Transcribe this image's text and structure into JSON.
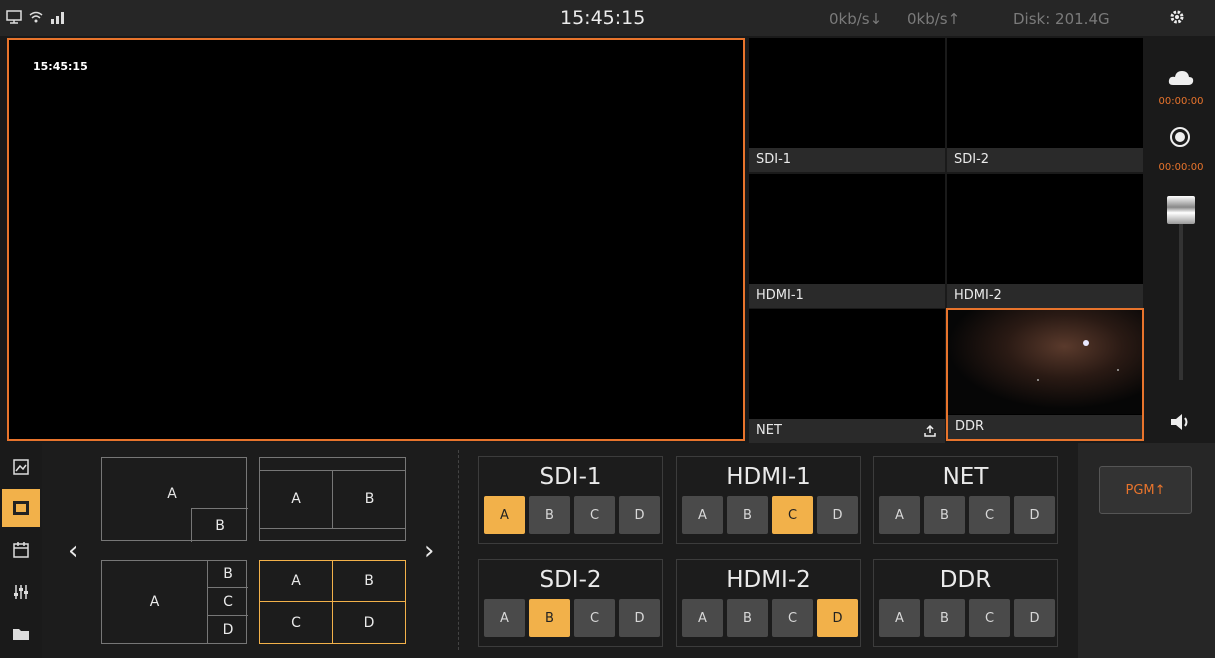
{
  "status": {
    "clock": "15:45:15",
    "down_rate": "0kb/s↓",
    "up_rate": "0kb/s↑",
    "disk": "Disk: 201.4G",
    "icons": [
      "monitor-icon",
      "wifi-icon",
      "signal-icon",
      "gear-icon"
    ]
  },
  "preview": {
    "timestamp": "15:45:15"
  },
  "sources": [
    {
      "label": "SDI-1"
    },
    {
      "label": "SDI-2"
    },
    {
      "label": "HDMI-1"
    },
    {
      "label": "HDMI-2"
    },
    {
      "label": "NET"
    },
    {
      "label": "DDR"
    }
  ],
  "rail": {
    "stream_timer": "00:00:00",
    "record_timer": "00:00:00",
    "icons": [
      "cloud-stream-icon",
      "record-icon",
      "volume-fader",
      "speaker-icon"
    ]
  },
  "sidebar": {
    "icons": [
      "image-icon",
      "pip-icon",
      "calendar-icon",
      "mixer-icon",
      "folder-icon"
    ],
    "active_index": 1
  },
  "layouts": {
    "pip": {
      "main": "A",
      "inset": "B"
    },
    "side_by_side": {
      "left": "A",
      "right": "B"
    },
    "one_plus_three": {
      "main": "A",
      "right": [
        "B",
        "C",
        "D"
      ]
    },
    "quad": {
      "cells": [
        "A",
        "B",
        "C",
        "D"
      ]
    },
    "selected": "quad"
  },
  "groups": [
    {
      "title": "SDI-1",
      "buttons": [
        "A",
        "B",
        "C",
        "D"
      ],
      "active": "A"
    },
    {
      "title": "HDMI-1",
      "buttons": [
        "A",
        "B",
        "C",
        "D"
      ],
      "active": "C"
    },
    {
      "title": "NET",
      "buttons": [
        "A",
        "B",
        "C",
        "D"
      ],
      "active": ""
    },
    {
      "title": "SDI-2",
      "buttons": [
        "A",
        "B",
        "C",
        "D"
      ],
      "active": "B"
    },
    {
      "title": "HDMI-2",
      "buttons": [
        "A",
        "B",
        "C",
        "D"
      ],
      "active": "D"
    },
    {
      "title": "DDR",
      "buttons": [
        "A",
        "B",
        "C",
        "D"
      ],
      "active": ""
    }
  ],
  "pgm": {
    "label": "PGM↑"
  },
  "colors": {
    "accent_orange": "#e8742c",
    "accent_yellow": "#f2b14a",
    "button_gray": "#4a4a4a"
  }
}
